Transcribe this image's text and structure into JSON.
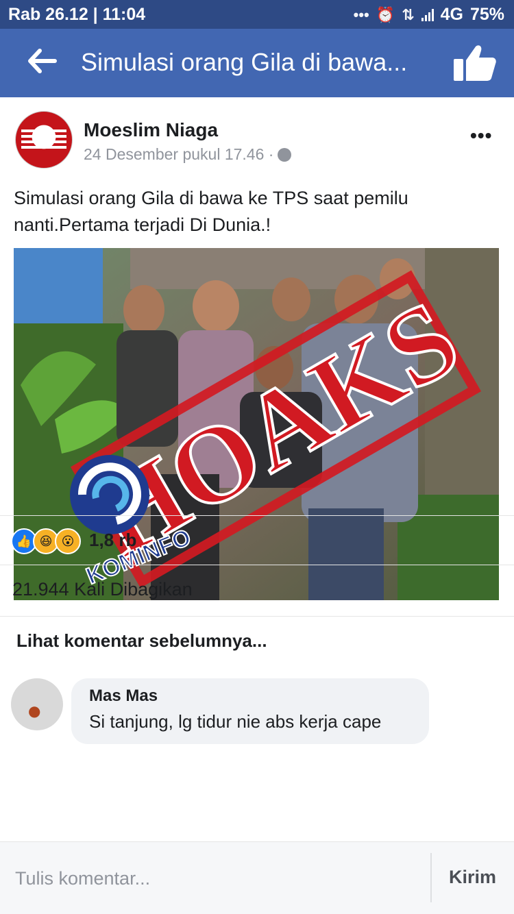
{
  "status_bar": {
    "datetime": "Rab 26.12 | 11:04",
    "network": "4G",
    "battery": "75%"
  },
  "app_bar": {
    "title": "Simulasi orang Gila di bawa..."
  },
  "post": {
    "author": "Moeslim Niaga",
    "timestamp": "24 Desember pukul 17.46 ·",
    "text": "Simulasi orang Gila di bawa ke TPS saat pemilu\nnanti.Pertama terjadi Di Dunia.!",
    "image": {
      "stamp_text": "HOAKS",
      "logo_text": "KOMINFO"
    }
  },
  "reactions": {
    "icons": [
      "like-icon",
      "haha-icon",
      "wow-icon"
    ],
    "count": "1,8 rb"
  },
  "shares": {
    "label": "21.944 Kali Dibagikan"
  },
  "comments": {
    "previous_label": "Lihat komentar sebelumnya...",
    "items": [
      {
        "name": "Mas Mas",
        "text": "Si tanjung, lg tidur nie abs kerja cape"
      }
    ]
  },
  "composer": {
    "placeholder": "Tulis komentar...",
    "send_label": "Kirim"
  },
  "colors": {
    "status_bar": "#2e4a85",
    "app_bar": "#4267b2",
    "stamp_red": "#d11a22"
  }
}
